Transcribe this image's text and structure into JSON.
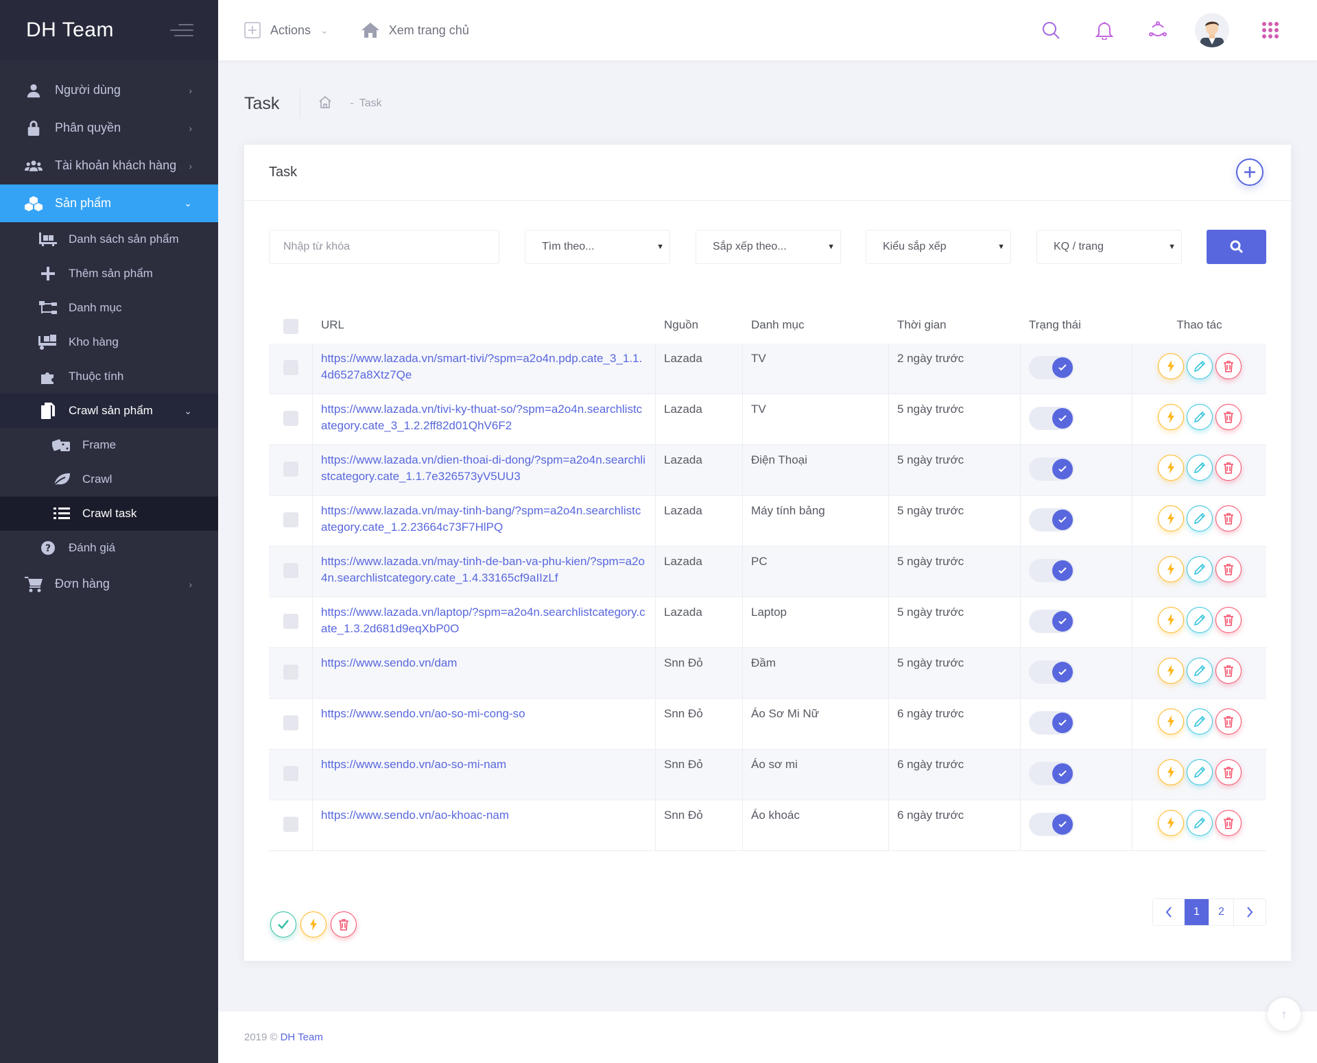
{
  "brand": {
    "name": "DH Team"
  },
  "sidebar": {
    "items": [
      {
        "label": "Người dùng",
        "icon": "user-icon"
      },
      {
        "label": "Phân quyền",
        "icon": "lock-icon"
      },
      {
        "label": "Tài khoản khách hàng",
        "icon": "users-icon"
      },
      {
        "label": "Sản phẩm",
        "icon": "cubes-icon"
      }
    ],
    "products_sub": [
      {
        "label": "Danh sách sản phẩm",
        "icon": "pallet-icon"
      },
      {
        "label": "Thêm sản phẩm",
        "icon": "plus-icon"
      },
      {
        "label": "Danh mục",
        "icon": "sitemap-icon"
      },
      {
        "label": "Kho hàng",
        "icon": "dolly-icon"
      },
      {
        "label": "Thuộc tính",
        "icon": "puzzle-icon"
      },
      {
        "label": "Crawl sản phẩm",
        "icon": "copy-icon"
      }
    ],
    "crawl_sub": [
      {
        "label": "Frame",
        "icon": "dice-icon"
      },
      {
        "label": "Crawl",
        "icon": "leaf-icon"
      },
      {
        "label": "Crawl task",
        "icon": "tasks-icon"
      }
    ],
    "review": {
      "label": "Đánh giá",
      "icon": "question-circle-icon"
    },
    "orders": {
      "label": "Đơn hàng",
      "icon": "cart-icon"
    }
  },
  "header": {
    "actions_label": "Actions",
    "home_label": "Xem trang chủ"
  },
  "subheader": {
    "title": "Task",
    "crumb": "Task"
  },
  "portlet": {
    "title": "Task"
  },
  "filters": {
    "keyword_placeholder": "Nhập từ khóa",
    "search_by": "Tìm theo...",
    "sort_by": "Sắp xếp theo...",
    "sort_type": "Kiểu sắp xếp",
    "per_page": "KQ / trang"
  },
  "table": {
    "columns": [
      "URL",
      "Nguồn",
      "Danh mục",
      "Thời gian",
      "Trạng thái",
      "Thao tác"
    ],
    "rows": [
      {
        "url": "https://www.lazada.vn/smart-tivi/?spm=a2o4n.pdp.cate_3_1.1.4d6527a8Xtz7Qe",
        "source": "Lazada",
        "category": "TV",
        "time": "2 ngày trước"
      },
      {
        "url": "https://www.lazada.vn/tivi-ky-thuat-so/?spm=a2o4n.searchlistcategory.cate_3_1.2.2ff82d01QhV6F2",
        "source": "Lazada",
        "category": "TV",
        "time": "5 ngày trước"
      },
      {
        "url": "https://www.lazada.vn/dien-thoai-di-dong/?spm=a2o4n.searchlistcategory.cate_1.1.7e326573yV5UU3",
        "source": "Lazada",
        "category": "Điện Thoại",
        "time": "5 ngày trước"
      },
      {
        "url": "https://www.lazada.vn/may-tinh-bang/?spm=a2o4n.searchlistcategory.cate_1.2.23664c73F7HlPQ",
        "source": "Lazada",
        "category": "Máy tính bảng",
        "time": "5 ngày trước"
      },
      {
        "url": "https://www.lazada.vn/may-tinh-de-ban-va-phu-kien/?spm=a2o4n.searchlistcategory.cate_1.4.33165cf9aIIzLf",
        "source": "Lazada",
        "category": "PC",
        "time": "5 ngày trước"
      },
      {
        "url": "https://www.lazada.vn/laptop/?spm=a2o4n.searchlistcategory.cate_1.3.2d681d9eqXbP0O",
        "source": "Lazada",
        "category": "Laptop",
        "time": "5 ngày trước"
      },
      {
        "url": "https://www.sendo.vn/dam",
        "source": "Snn Đỏ",
        "category": "Đầm",
        "time": "5 ngày trước"
      },
      {
        "url": "https://www.sendo.vn/ao-so-mi-cong-so",
        "source": "Snn Đỏ",
        "category": "Áo Sơ Mi Nữ",
        "time": "6 ngày trước"
      },
      {
        "url": "https://www.sendo.vn/ao-so-mi-nam",
        "source": "Snn Đỏ",
        "category": "Áo sơ mi",
        "time": "6 ngày trước"
      },
      {
        "url": "https://www.sendo.vn/ao-khoac-nam",
        "source": "Snn Đỏ",
        "category": "Áo khoác",
        "time": "6 ngày trước"
      }
    ]
  },
  "pagination": {
    "pages": [
      "1",
      "2"
    ],
    "current": "1"
  },
  "footer": {
    "copyright": "2019 ©",
    "brand": "DH Team"
  },
  "colors": {
    "primary": "#5867dd",
    "sidebar": "#2c2e3e",
    "active": "#35a3f5",
    "warning": "#ffb822",
    "info": "#34bfa3",
    "danger": "#f4516c"
  }
}
